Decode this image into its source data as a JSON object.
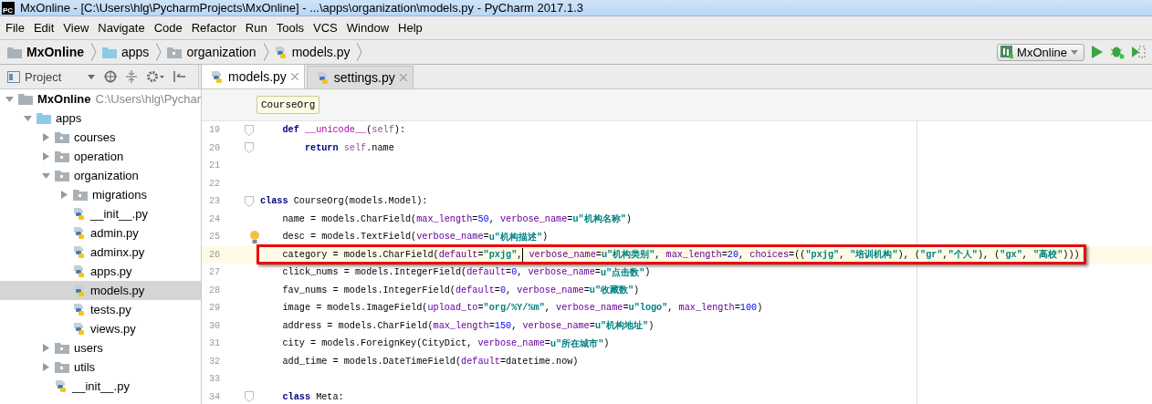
{
  "window": {
    "title": "MxOnline - [C:\\Users\\hlg\\PycharmProjects\\MxOnline] - ...\\apps\\organization\\models.py - PyCharm 2017.1.3",
    "app_badge": "PC"
  },
  "menu": [
    "File",
    "Edit",
    "View",
    "Navigate",
    "Code",
    "Refactor",
    "Run",
    "Tools",
    "VCS",
    "Window",
    "Help"
  ],
  "breadcrumb": [
    {
      "label": "MxOnline",
      "kind": "project"
    },
    {
      "label": "apps",
      "kind": "source-folder"
    },
    {
      "label": "organization",
      "kind": "folder"
    },
    {
      "label": "models.py",
      "kind": "file"
    }
  ],
  "run_config": {
    "label": "MxOnline"
  },
  "project_panel": {
    "label": "Project"
  },
  "tabs": [
    {
      "label": "models.py",
      "selected": true
    },
    {
      "label": "settings.py",
      "selected": false
    }
  ],
  "tree": [
    {
      "label": "MxOnline",
      "kind": "project",
      "path": "C:\\Users\\hlg\\Pychar",
      "expanded": true,
      "selected": false,
      "children": [
        {
          "label": "apps",
          "kind": "source-folder",
          "expanded": true,
          "selected": false,
          "children": [
            {
              "label": "courses",
              "kind": "folder",
              "expanded": false,
              "selected": false
            },
            {
              "label": "operation",
              "kind": "folder",
              "expanded": false,
              "selected": false
            },
            {
              "label": "organization",
              "kind": "folder",
              "expanded": true,
              "selected": false,
              "children": [
                {
                  "label": "migrations",
                  "kind": "folder",
                  "expanded": false,
                  "selected": false
                },
                {
                  "label": "__init__.py",
                  "kind": "file",
                  "selected": false
                },
                {
                  "label": "admin.py",
                  "kind": "file",
                  "selected": false
                },
                {
                  "label": "adminx.py",
                  "kind": "file",
                  "selected": false
                },
                {
                  "label": "apps.py",
                  "kind": "file",
                  "selected": false
                },
                {
                  "label": "models.py",
                  "kind": "file",
                  "selected": true
                },
                {
                  "label": "tests.py",
                  "kind": "file",
                  "selected": false
                },
                {
                  "label": "views.py",
                  "kind": "file",
                  "selected": false
                }
              ]
            },
            {
              "label": "users",
              "kind": "folder",
              "expanded": false,
              "selected": false
            },
            {
              "label": "utils",
              "kind": "folder",
              "expanded": false,
              "selected": false
            },
            {
              "label": "__init__.py",
              "kind": "file",
              "selected": false
            }
          ]
        }
      ]
    }
  ],
  "editor": {
    "scope": "CourseOrg",
    "lines": [
      {
        "number": "19",
        "fold": true,
        "tokens": [
          {
            "kind": "kw",
            "text": "    def "
          },
          {
            "kind": "magic",
            "text": "__unicode__"
          },
          {
            "kind": "plain",
            "text": "("
          },
          {
            "kind": "self",
            "text": "self"
          },
          {
            "kind": "plain",
            "text": "):"
          }
        ]
      },
      {
        "number": "20",
        "fold": true,
        "tokens": [
          {
            "kind": "kw",
            "text": "        return "
          },
          {
            "kind": "self",
            "text": "self"
          },
          {
            "kind": "plain",
            "text": ".name"
          }
        ]
      },
      {
        "number": "21"
      },
      {
        "number": "22"
      },
      {
        "number": "23",
        "fold": true,
        "tokens": [
          {
            "kind": "kw",
            "text": "class"
          },
          {
            "kind": "plain",
            "text": " CourseOrg(models.Model):"
          }
        ]
      },
      {
        "number": "24",
        "tokens": [
          {
            "kind": "plain",
            "text": "    name = models.CharField("
          },
          {
            "kind": "param",
            "text": "max_length"
          },
          {
            "kind": "plain",
            "text": "="
          },
          {
            "kind": "num",
            "text": "50"
          },
          {
            "kind": "plain",
            "text": ", "
          },
          {
            "kind": "param",
            "text": "verbose_name"
          },
          {
            "kind": "plain",
            "text": "="
          },
          {
            "kind": "str",
            "text": "u\"机构名称\""
          },
          {
            "kind": "plain",
            "text": ")"
          }
        ]
      },
      {
        "number": "25",
        "bulb": true,
        "tokens": [
          {
            "kind": "plain",
            "text": "    desc = models.TextField("
          },
          {
            "kind": "param",
            "text": "verbose_name"
          },
          {
            "kind": "plain",
            "text": "="
          },
          {
            "kind": "str",
            "text": "u\"机构描述\""
          },
          {
            "kind": "plain",
            "text": ")"
          }
        ]
      },
      {
        "number": "26",
        "current": true,
        "boxed": true,
        "tokens": [
          {
            "kind": "plain",
            "text": "    category = models.CharField("
          },
          {
            "kind": "param",
            "text": "default"
          },
          {
            "kind": "plain",
            "text": "="
          },
          {
            "kind": "str",
            "text": "\"pxjg\""
          },
          {
            "kind": "plain",
            "text": ",",
            "caret": true
          },
          {
            "kind": "param",
            "text": " verbose_name"
          },
          {
            "kind": "plain",
            "text": "="
          },
          {
            "kind": "str",
            "text": "u\"机构类别\""
          },
          {
            "kind": "plain",
            "text": ", "
          },
          {
            "kind": "param",
            "text": "max_length"
          },
          {
            "kind": "plain",
            "text": "="
          },
          {
            "kind": "num",
            "text": "20"
          },
          {
            "kind": "plain",
            "text": ", "
          },
          {
            "kind": "param",
            "text": "choices"
          },
          {
            "kind": "plain",
            "text": "=(("
          },
          {
            "kind": "str",
            "text": "\"pxjg\""
          },
          {
            "kind": "plain",
            "text": ", "
          },
          {
            "kind": "str",
            "text": "\"培训机构\""
          },
          {
            "kind": "plain",
            "text": "), ("
          },
          {
            "kind": "str",
            "text": "\"gr\""
          },
          {
            "kind": "plain",
            "text": ","
          },
          {
            "kind": "str",
            "text": "\"个人\""
          },
          {
            "kind": "plain",
            "text": "), ("
          },
          {
            "kind": "str",
            "text": "\"gx\""
          },
          {
            "kind": "plain",
            "text": ", "
          },
          {
            "kind": "str",
            "text": "\"高校\""
          },
          {
            "kind": "plain",
            "text": ")))"
          }
        ]
      },
      {
        "number": "27",
        "tokens": [
          {
            "kind": "plain",
            "text": "    click_nums = models.IntegerField("
          },
          {
            "kind": "param",
            "text": "default"
          },
          {
            "kind": "plain",
            "text": "="
          },
          {
            "kind": "num",
            "text": "0"
          },
          {
            "kind": "plain",
            "text": ", "
          },
          {
            "kind": "param",
            "text": "verbose_name"
          },
          {
            "kind": "plain",
            "text": "="
          },
          {
            "kind": "str",
            "text": "u\"点击数\""
          },
          {
            "kind": "plain",
            "text": ")"
          }
        ]
      },
      {
        "number": "28",
        "tokens": [
          {
            "kind": "plain",
            "text": "    fav_nums = models.IntegerField("
          },
          {
            "kind": "param",
            "text": "default"
          },
          {
            "kind": "plain",
            "text": "="
          },
          {
            "kind": "num",
            "text": "0"
          },
          {
            "kind": "plain",
            "text": ", "
          },
          {
            "kind": "param",
            "text": "verbose_name"
          },
          {
            "kind": "plain",
            "text": "="
          },
          {
            "kind": "str",
            "text": "u\"收藏数\""
          },
          {
            "kind": "plain",
            "text": ")"
          }
        ]
      },
      {
        "number": "29",
        "tokens": [
          {
            "kind": "plain",
            "text": "    image = models.ImageField("
          },
          {
            "kind": "param",
            "text": "upload_to"
          },
          {
            "kind": "plain",
            "text": "="
          },
          {
            "kind": "str",
            "text": "\"org/%Y/%m\""
          },
          {
            "kind": "plain",
            "text": ", "
          },
          {
            "kind": "param",
            "text": "verbose_name"
          },
          {
            "kind": "plain",
            "text": "="
          },
          {
            "kind": "str",
            "text": "u\"logo\""
          },
          {
            "kind": "plain",
            "text": ", "
          },
          {
            "kind": "param",
            "text": "max_length"
          },
          {
            "kind": "plain",
            "text": "="
          },
          {
            "kind": "num",
            "text": "100"
          },
          {
            "kind": "plain",
            "text": ")"
          }
        ]
      },
      {
        "number": "30",
        "tokens": [
          {
            "kind": "plain",
            "text": "    address = models.CharField("
          },
          {
            "kind": "param",
            "text": "max_length"
          },
          {
            "kind": "plain",
            "text": "="
          },
          {
            "kind": "num",
            "text": "150"
          },
          {
            "kind": "plain",
            "text": ", "
          },
          {
            "kind": "param",
            "text": "verbose_name"
          },
          {
            "kind": "plain",
            "text": "="
          },
          {
            "kind": "str",
            "text": "u\"机构地址\""
          },
          {
            "kind": "plain",
            "text": ")"
          }
        ]
      },
      {
        "number": "31",
        "tokens": [
          {
            "kind": "plain",
            "text": "    city = models.ForeignKey(CityDict, "
          },
          {
            "kind": "param",
            "text": "verbose_name"
          },
          {
            "kind": "plain",
            "text": "="
          },
          {
            "kind": "str",
            "text": "u\"所在城市\""
          },
          {
            "kind": "plain",
            "text": ")"
          }
        ]
      },
      {
        "number": "32",
        "tokens": [
          {
            "kind": "plain",
            "text": "    add_time = models.DateTimeField("
          },
          {
            "kind": "param",
            "text": "default"
          },
          {
            "kind": "plain",
            "text": "=datetime.now)"
          }
        ]
      },
      {
        "number": "33"
      },
      {
        "number": "34",
        "fold": true,
        "tokens": [
          {
            "kind": "kw",
            "text": "    class"
          },
          {
            "kind": "plain",
            "text": " Meta:"
          }
        ]
      }
    ]
  }
}
